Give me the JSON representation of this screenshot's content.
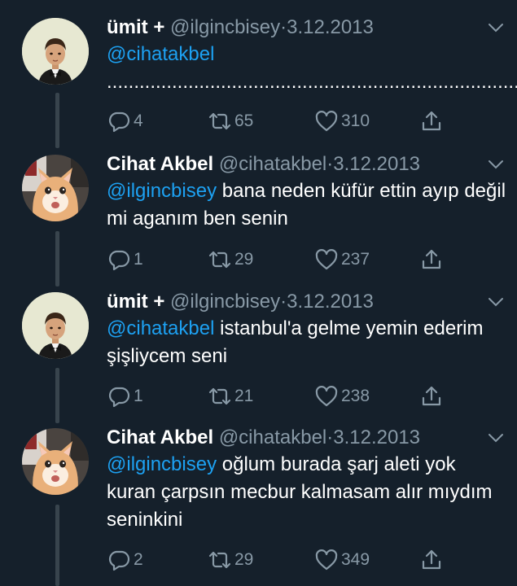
{
  "tweets": [
    {
      "display_name": "ümit +",
      "handle": "@ilgincbisey",
      "separator": "·",
      "date": "3.12.2013",
      "mention": "@cihatakbel",
      "text": " ..............................................................................",
      "replies": "4",
      "retweets": "65",
      "likes": "310",
      "avatar": "boy-avatar"
    },
    {
      "display_name": "Cihat Akbel",
      "handle": "@cihatakbel",
      "separator": "·",
      "date": "3.12.2013",
      "mention": "@ilgincbisey",
      "text": " bana neden küfür ettin ayıp değil mi aganım ben senin",
      "replies": "1",
      "retweets": "29",
      "likes": "237",
      "avatar": "cat-avatar"
    },
    {
      "display_name": "ümit +",
      "handle": "@ilgincbisey",
      "separator": "·",
      "date": "3.12.2013",
      "mention": "@cihatakbel",
      "text": " istanbul'a gelme yemin ederim şişliycem seni",
      "replies": "1",
      "retweets": "21",
      "likes": "238",
      "avatar": "boy-avatar"
    },
    {
      "display_name": "Cihat Akbel",
      "handle": "@cihatakbel",
      "separator": "·",
      "date": "3.12.2013",
      "mention": "@ilgincbisey",
      "text": " oğlum burada şarj aleti yok kuran çarpsın mecbur kalmasam alır mıydım seninkini",
      "replies": "2",
      "retweets": "29",
      "likes": "349",
      "avatar": "cat-avatar"
    }
  ],
  "icons": {
    "reply": "reply-icon",
    "retweet": "retweet-icon",
    "like": "heart-icon",
    "share": "share-icon",
    "menu": "chevron-down-icon"
  },
  "colors": {
    "background": "#15202b",
    "text": "#ffffff",
    "secondary": "#8899a6",
    "link": "#1da1f2",
    "thread_line": "#38444d"
  }
}
